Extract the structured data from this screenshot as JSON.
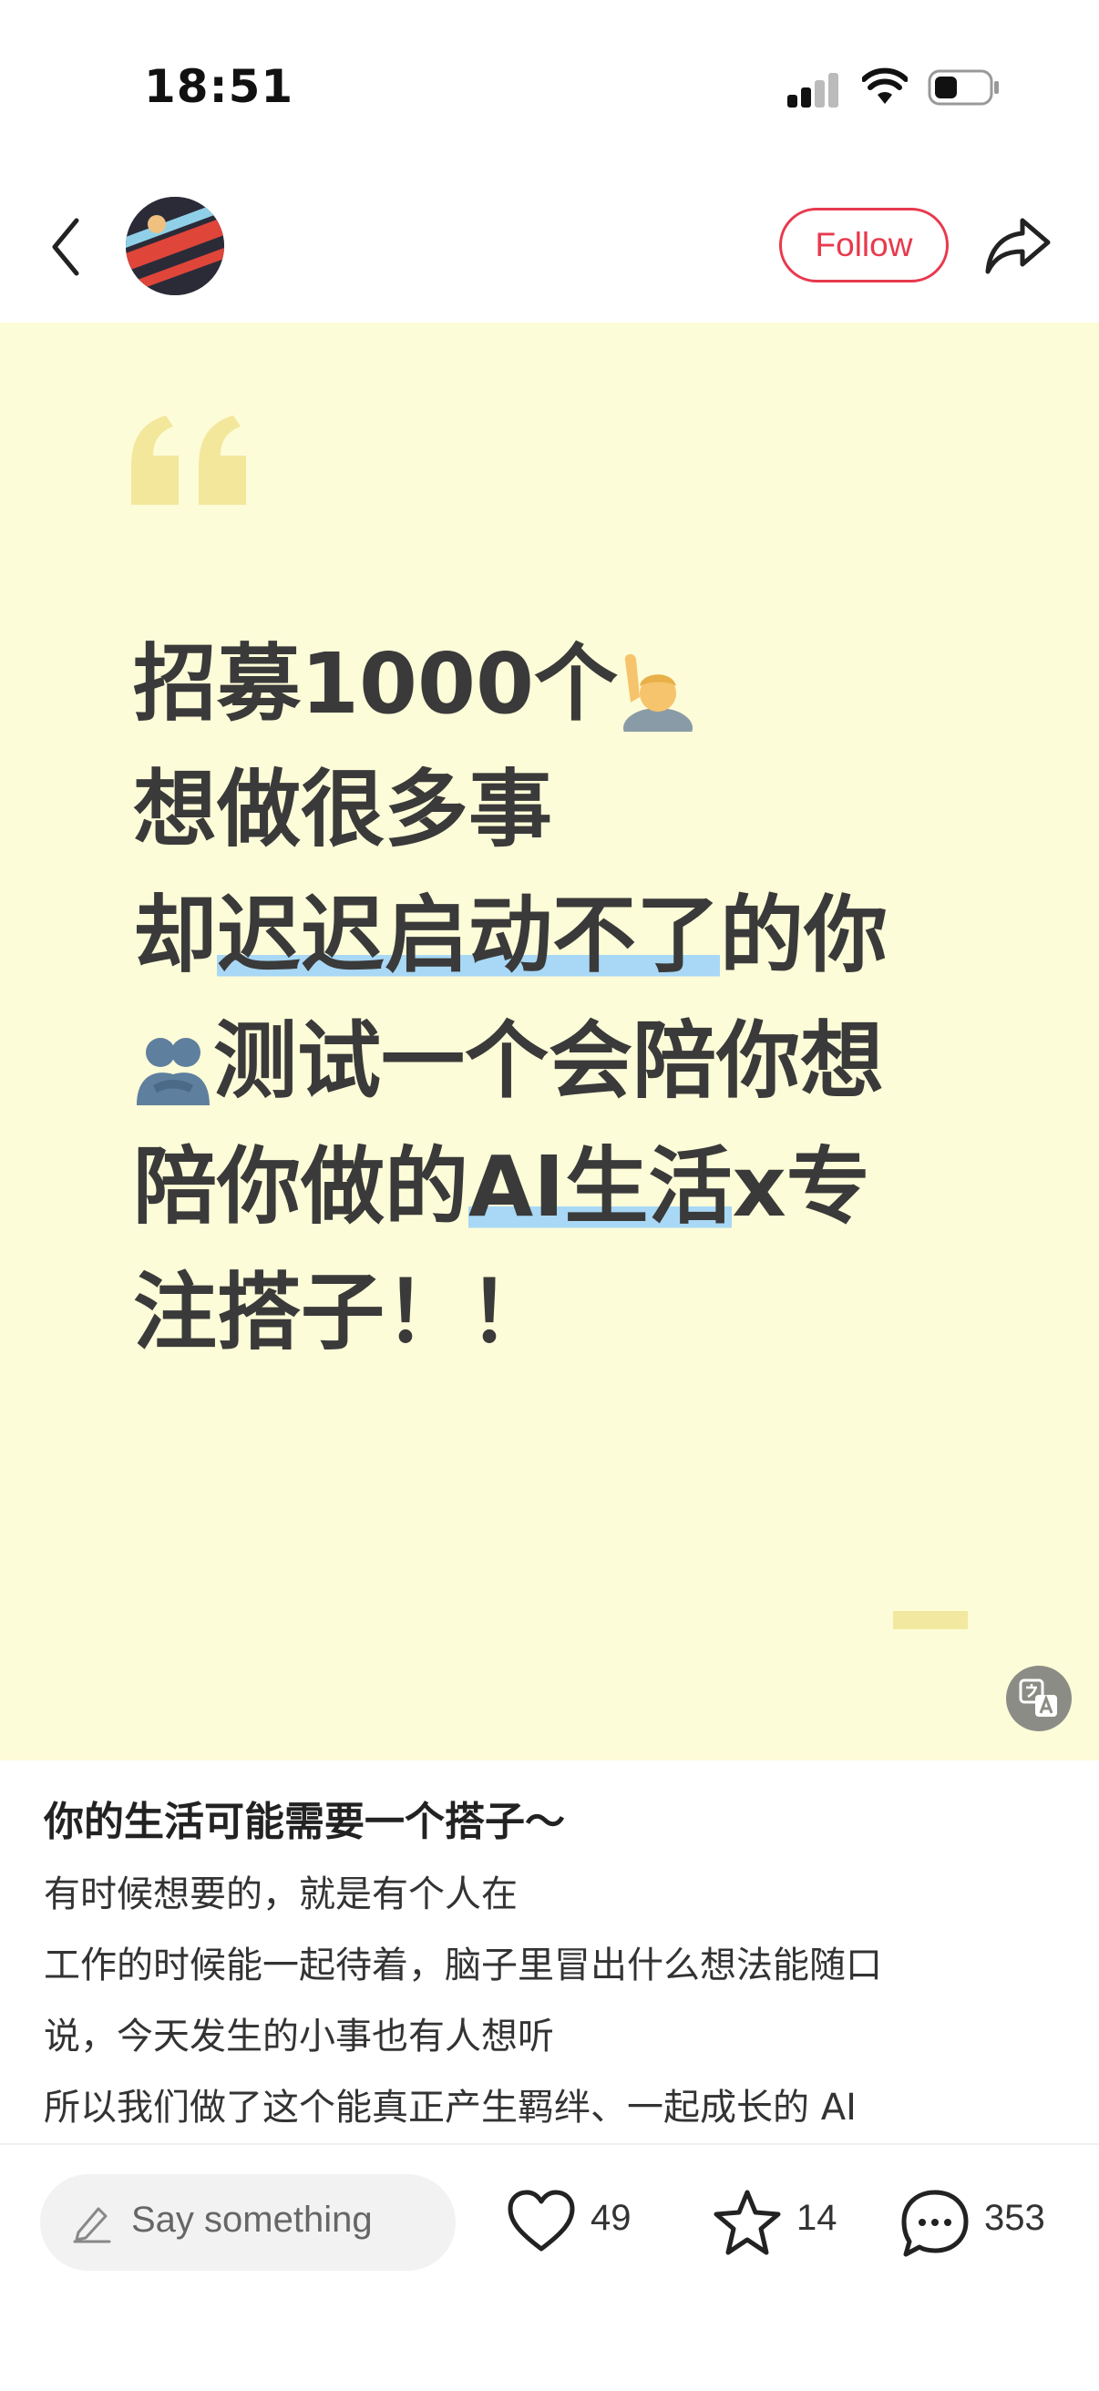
{
  "status_bar": {
    "time": "18:51"
  },
  "header": {
    "follow_label": "Follow"
  },
  "cover": {
    "headline_lines": [
      {
        "before": "招募1000个",
        "highlight": "",
        "after": ""
      },
      {
        "before": "想做很多事",
        "highlight": "",
        "after": ""
      },
      {
        "before": "却",
        "highlight": "迟迟启动不了",
        "after": "的你"
      },
      {
        "before": "测试一个会陪你想",
        "highlight": "",
        "after": ""
      },
      {
        "before": "陪你做的",
        "highlight": "AI生活",
        "after": "x专"
      },
      {
        "before": "注搭子！！",
        "highlight": "",
        "after": ""
      }
    ],
    "accent_color": "#a8d8f5",
    "background_color": "#fdfcd8"
  },
  "post": {
    "title": "你的生活可能需要一个搭子～",
    "body": [
      "有时候想要的，就是有个人在",
      "工作的时候能一起待着，脑子里冒出什么想法能随口",
      "说，今天发生的小事也有人想听",
      "所以我们做了这个能真正产生羁绊、一起成长的 AI"
    ]
  },
  "bottom_bar": {
    "comment_placeholder": "Say something",
    "likes": "49",
    "favorites": "14",
    "comments": "353"
  },
  "colors": {
    "follow": "#e8394d"
  }
}
